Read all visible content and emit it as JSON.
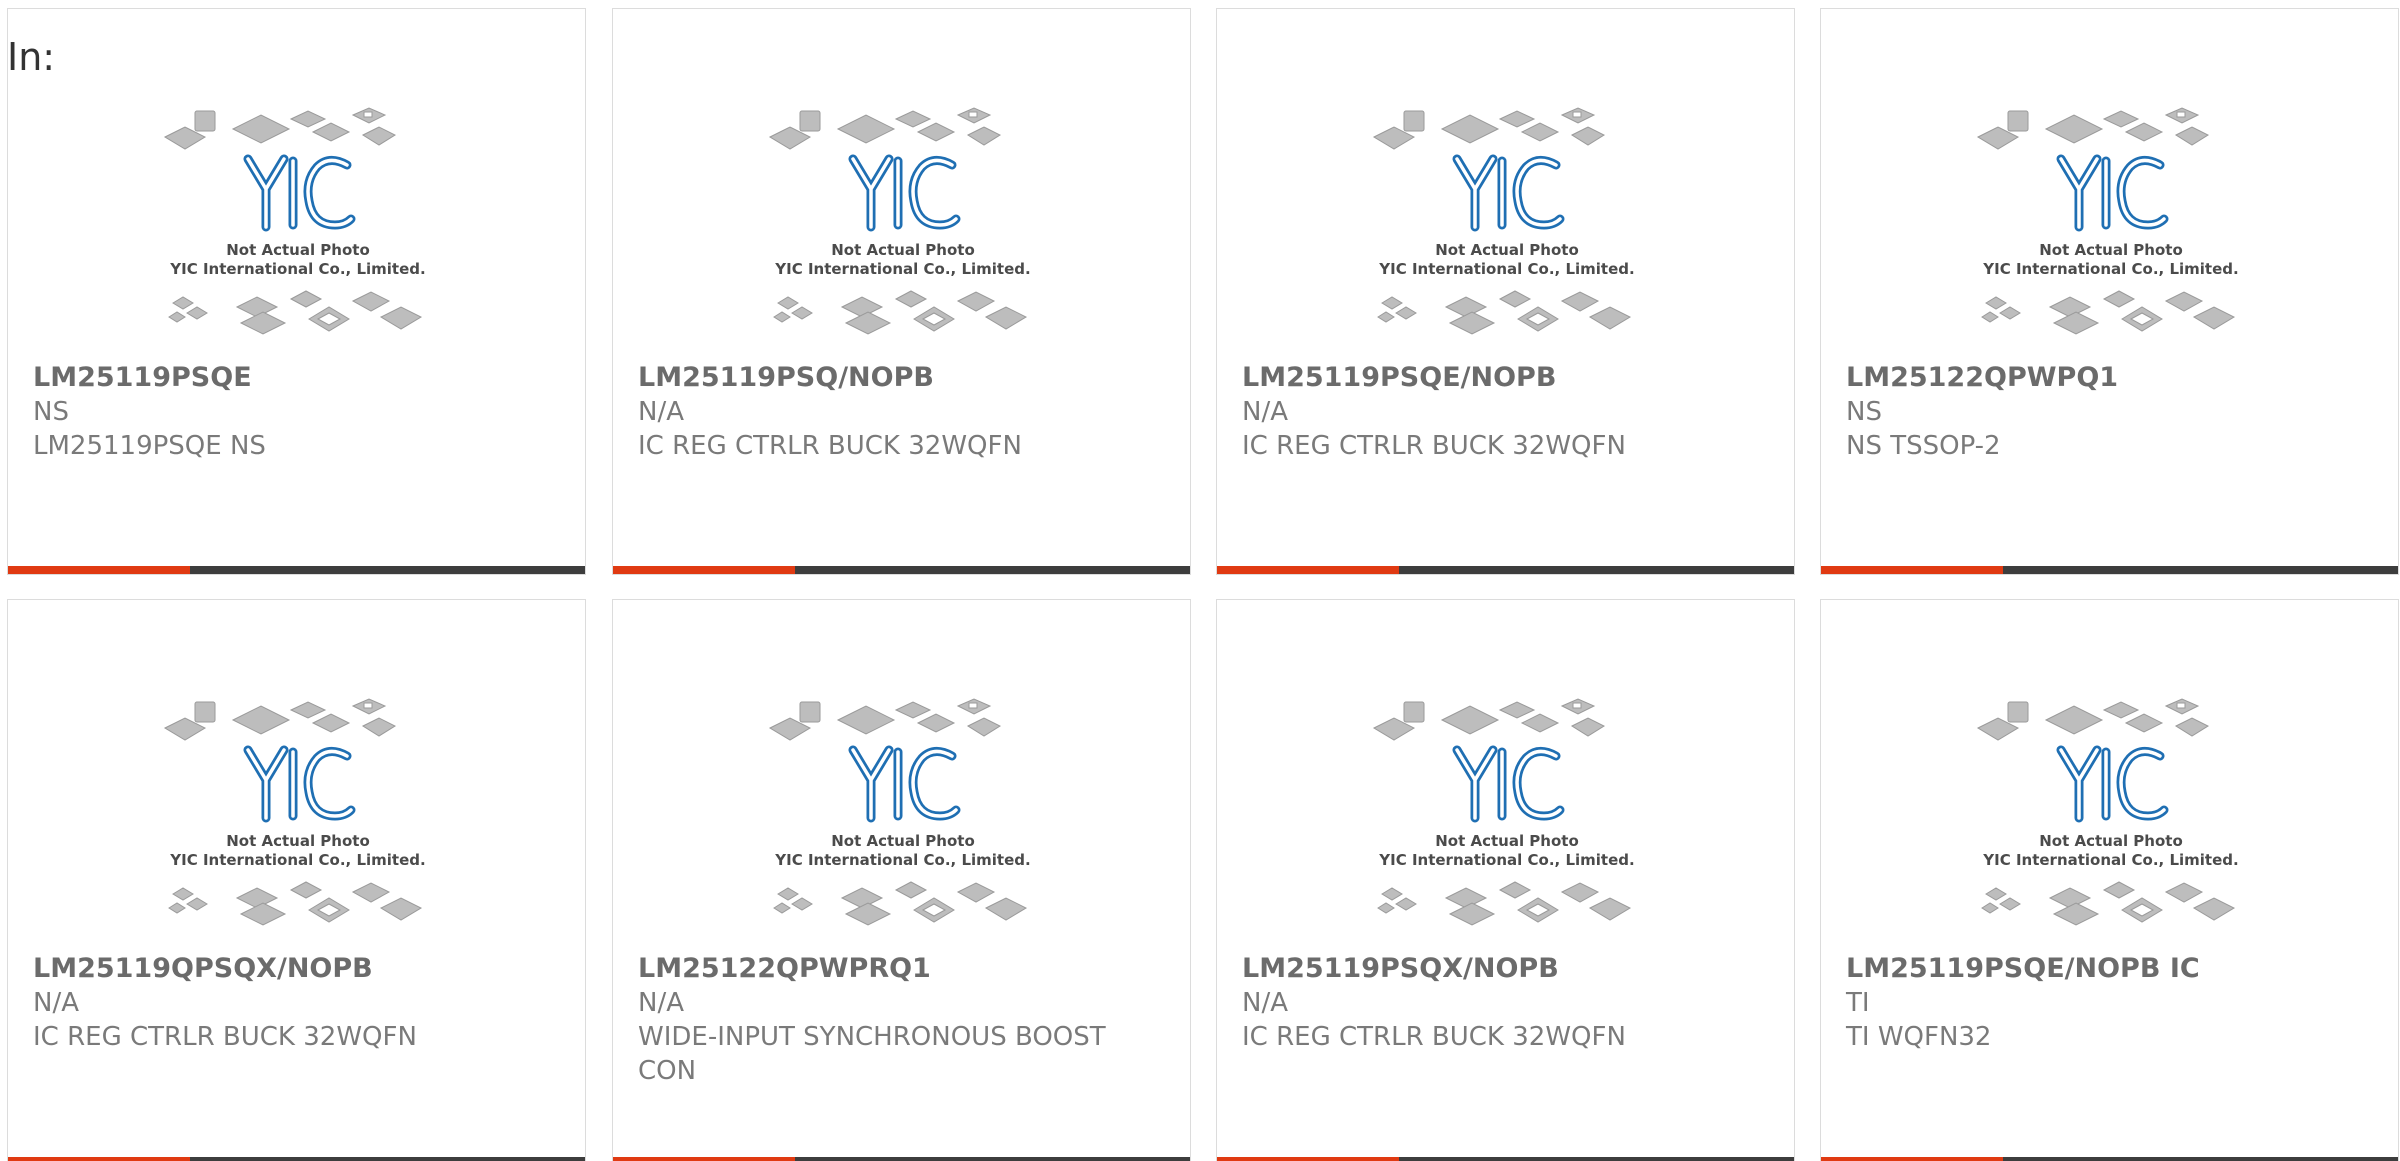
{
  "header": {
    "label": "In:"
  },
  "photo_caption": {
    "line1": "Not Actual Photo",
    "line2": "YIC International Co., Limited.",
    "logo_text": "YIC"
  },
  "colors": {
    "accent": "#e03a12",
    "bar": "#3d3d3d",
    "logo_blue": "#2a8fcf",
    "text_gray": "#6b6b6b"
  },
  "products": [
    {
      "part": "LM25119PSQE",
      "manufacturer": "NS",
      "description": "LM25119PSQE NS"
    },
    {
      "part": "LM25119PSQ/NOPB",
      "manufacturer": "N/A",
      "description": "IC REG CTRLR BUCK 32WQFN"
    },
    {
      "part": "LM25119PSQE/NOPB",
      "manufacturer": "N/A",
      "description": "IC REG CTRLR BUCK 32WQFN"
    },
    {
      "part": "LM25122QPWPQ1",
      "manufacturer": "NS",
      "description": "NS TSSOP-2"
    },
    {
      "part": "LM25119QPSQX/NOPB",
      "manufacturer": "N/A",
      "description": "IC REG CTRLR BUCK 32WQFN"
    },
    {
      "part": "LM25122QPWPRQ1",
      "manufacturer": "N/A",
      "description": "WIDE-INPUT SYNCHRONOUS BOOST CON"
    },
    {
      "part": "LM25119PSQX/NOPB",
      "manufacturer": "N/A",
      "description": "IC REG CTRLR BUCK 32WQFN"
    },
    {
      "part": "LM25119PSQE/NOPB IC",
      "manufacturer": "TI",
      "description": "TI WQFN32"
    }
  ]
}
